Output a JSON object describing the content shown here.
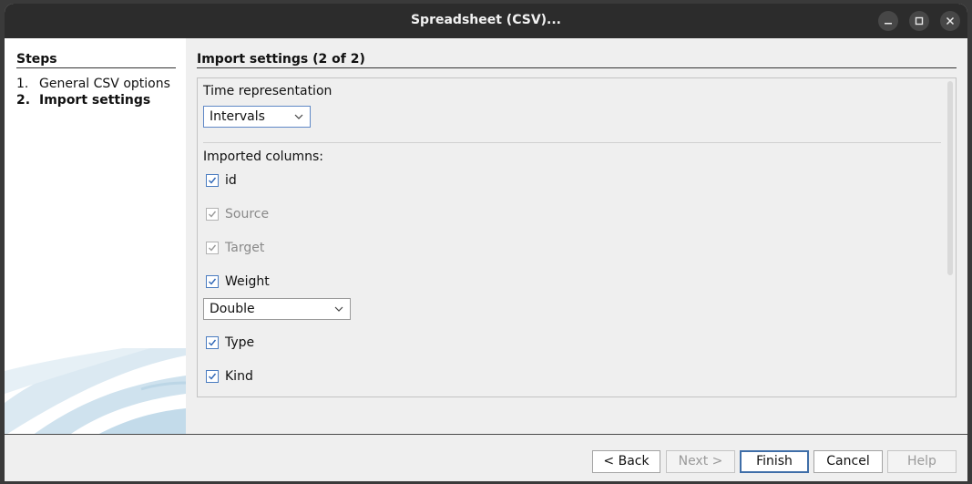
{
  "window": {
    "title": "Spreadsheet (CSV)...",
    "controls": [
      "minimize-icon",
      "maximize-icon",
      "close-icon"
    ]
  },
  "steps": {
    "title": "Steps",
    "items": [
      {
        "num": "1.",
        "label": "General CSV options",
        "current": false
      },
      {
        "num": "2.",
        "label": "Import settings",
        "current": true
      }
    ]
  },
  "main": {
    "title": "Import settings (2 of 2)",
    "time_label": "Time representation",
    "time_value": "Intervals",
    "columns_label": "Imported columns:",
    "columns": [
      {
        "label": "id",
        "checked": true,
        "enabled": true
      },
      {
        "label": "Source",
        "checked": true,
        "enabled": false
      },
      {
        "label": "Target",
        "checked": true,
        "enabled": false
      },
      {
        "label": "Weight",
        "checked": true,
        "enabled": true,
        "type": "Double"
      },
      {
        "label": "Type",
        "checked": true,
        "enabled": true
      },
      {
        "label": "Kind",
        "checked": true,
        "enabled": true
      }
    ]
  },
  "buttons": {
    "back": "< Back",
    "next": "Next >",
    "finish": "Finish",
    "cancel": "Cancel",
    "help": "Help"
  },
  "colors": {
    "titlebar": "#2c2c2c",
    "accent": "#3f6ea8",
    "checkbox": "#4a7cc0"
  }
}
